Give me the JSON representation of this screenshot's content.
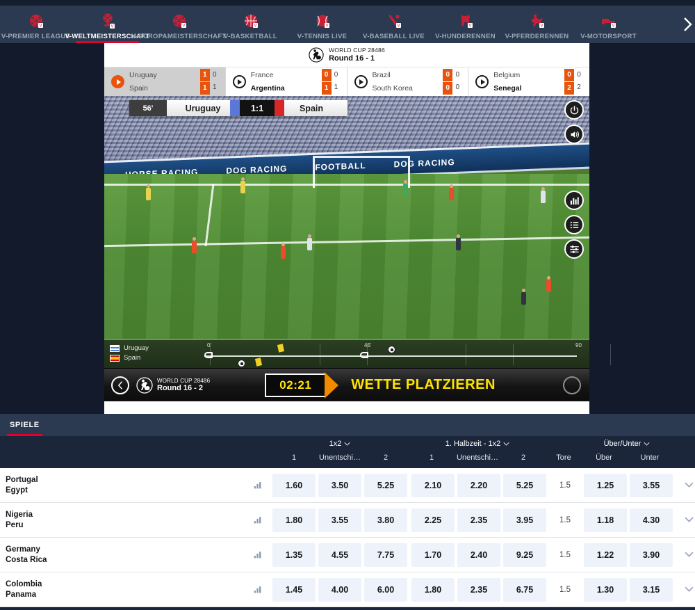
{
  "nav": {
    "items": [
      {
        "label": "V-PREMIER LEAGUE",
        "icon": "football-icon",
        "active": false
      },
      {
        "label": "V-WELTMEISTERSCHAFT",
        "icon": "trophy-football-icon",
        "active": true
      },
      {
        "label": "V-EUROPAMEISTERSCHAFT",
        "icon": "football-icon",
        "active": false
      },
      {
        "label": "V-BASKETBALL",
        "icon": "basketball-icon",
        "active": false
      },
      {
        "label": "V-TENNIS LIVE",
        "icon": "tennis-ball-icon",
        "active": false
      },
      {
        "label": "V-BASEBALL LIVE",
        "icon": "baseball-bat-icon",
        "active": false
      },
      {
        "label": "V-HUNDERENNEN",
        "icon": "greyhound-icon",
        "active": false
      },
      {
        "label": "V-PFERDERENNEN",
        "icon": "horse-racing-icon",
        "active": false
      },
      {
        "label": "V-MOTORSPORT",
        "icon": "racing-car-icon",
        "active": false
      }
    ],
    "scroll_right_icon": "chevron-right-icon"
  },
  "scoreboard": {
    "competition": "WORLD CUP 28486",
    "round": "Round 16 - 1",
    "logo_icon": "football-player-icon",
    "matches": [
      {
        "active": true,
        "home": "Uruguay",
        "away": "Spain",
        "home_primary": "1",
        "home_secondary": "0",
        "away_primary": "1",
        "away_secondary": "1",
        "bold_team": ""
      },
      {
        "active": false,
        "home": "France",
        "away": "Argentina",
        "home_primary": "0",
        "home_secondary": "0",
        "away_primary": "1",
        "away_secondary": "1",
        "bold_team": "away"
      },
      {
        "active": false,
        "home": "Brazil",
        "away": "South Korea",
        "home_primary": "0",
        "home_secondary": "0",
        "away_primary": "0",
        "away_secondary": "0",
        "bold_team": ""
      },
      {
        "active": false,
        "home": "Belgium",
        "away": "Senegal",
        "home_primary": "0",
        "home_secondary": "0",
        "away_primary": "2",
        "away_secondary": "2",
        "bold_team": "away"
      }
    ]
  },
  "video": {
    "overlay": {
      "minute": "56'",
      "home_team": "Uruguay",
      "score": "1:1",
      "away_team": "Spain"
    },
    "hoardings": [
      "HORSE RACING",
      "DOG RACING",
      "FOOTBALL",
      "DOG RACING"
    ],
    "controls": [
      {
        "icon": "power-icon"
      },
      {
        "icon": "volume-icon"
      }
    ],
    "controls_lower": [
      {
        "icon": "stats-bars-icon"
      },
      {
        "icon": "list-icon"
      },
      {
        "icon": "settings-sliders-icon"
      }
    ]
  },
  "timeline": {
    "home_team": "Uruguay",
    "away_team": "Spain",
    "labels": [
      "0'",
      "45'",
      "90"
    ],
    "home_flag_colors": [
      "#ffffff",
      "#4a7fd4"
    ],
    "away_flag_colors": [
      "#c60b1e",
      "#ffc400"
    ]
  },
  "betbar": {
    "back_icon": "chevron-left-icon",
    "logo_icon": "football-player-icon",
    "competition": "WORLD CUP 28486",
    "round": "Round 16 - 2",
    "timer": "02:21",
    "place_bet_label": "WETTE PLATZIEREN",
    "circle_icon": "bet-slip-icon",
    "timer_color": "#ffe400",
    "arrow_color": "#f08a00"
  },
  "panel": {
    "tabs": [
      {
        "label": "SPIELE",
        "active": true
      }
    ],
    "groups": [
      {
        "title": "1x2",
        "chevron": "chevron-down-icon",
        "subs": [
          "1",
          "Unentschi…",
          "2"
        ]
      },
      {
        "title": "1. Halbzeit - 1x2",
        "chevron": "chevron-down-icon",
        "subs": [
          "1",
          "Unentschi…",
          "2"
        ]
      },
      {
        "title": "Über/Unter",
        "chevron": "chevron-down-icon",
        "subs": [
          "Tore",
          "Über",
          "Unter"
        ]
      }
    ],
    "rows": [
      {
        "home": "Portugal",
        "away": "Egypt",
        "stats_icon": "stats-bars-icon",
        "odds_1x2": [
          "1.60",
          "3.50",
          "5.25"
        ],
        "odds_ht": [
          "2.10",
          "2.20",
          "5.25"
        ],
        "tore": "1.5",
        "odds_ou": [
          "1.25",
          "3.55"
        ],
        "chevron": "chevron-down-icon"
      },
      {
        "home": "Nigeria",
        "away": "Peru",
        "stats_icon": "stats-bars-icon",
        "odds_1x2": [
          "1.80",
          "3.55",
          "3.80"
        ],
        "odds_ht": [
          "2.25",
          "2.35",
          "3.95"
        ],
        "tore": "1.5",
        "odds_ou": [
          "1.18",
          "4.30"
        ],
        "chevron": "chevron-down-icon"
      },
      {
        "home": "Germany",
        "away": "Costa Rica",
        "stats_icon": "stats-bars-icon",
        "odds_1x2": [
          "1.35",
          "4.55",
          "7.75"
        ],
        "odds_ht": [
          "1.70",
          "2.40",
          "9.25"
        ],
        "tore": "1.5",
        "odds_ou": [
          "1.22",
          "3.90"
        ],
        "chevron": "chevron-down-icon"
      },
      {
        "home": "Colombia",
        "away": "Panama",
        "stats_icon": "stats-bars-icon",
        "odds_1x2": [
          "1.45",
          "4.00",
          "6.00"
        ],
        "odds_ht": [
          "1.80",
          "2.35",
          "6.75"
        ],
        "tore": "1.5",
        "odds_ou": [
          "1.30",
          "3.15"
        ],
        "chevron": "chevron-down-icon"
      }
    ]
  },
  "colors": {
    "nav_bg": "#2b3a50",
    "page_bg": "#121a2b",
    "accent_red": "#e4002b",
    "accent_orange": "#e8540c",
    "icon_red": "#c62037",
    "odd_bg": "#eef2fa"
  }
}
